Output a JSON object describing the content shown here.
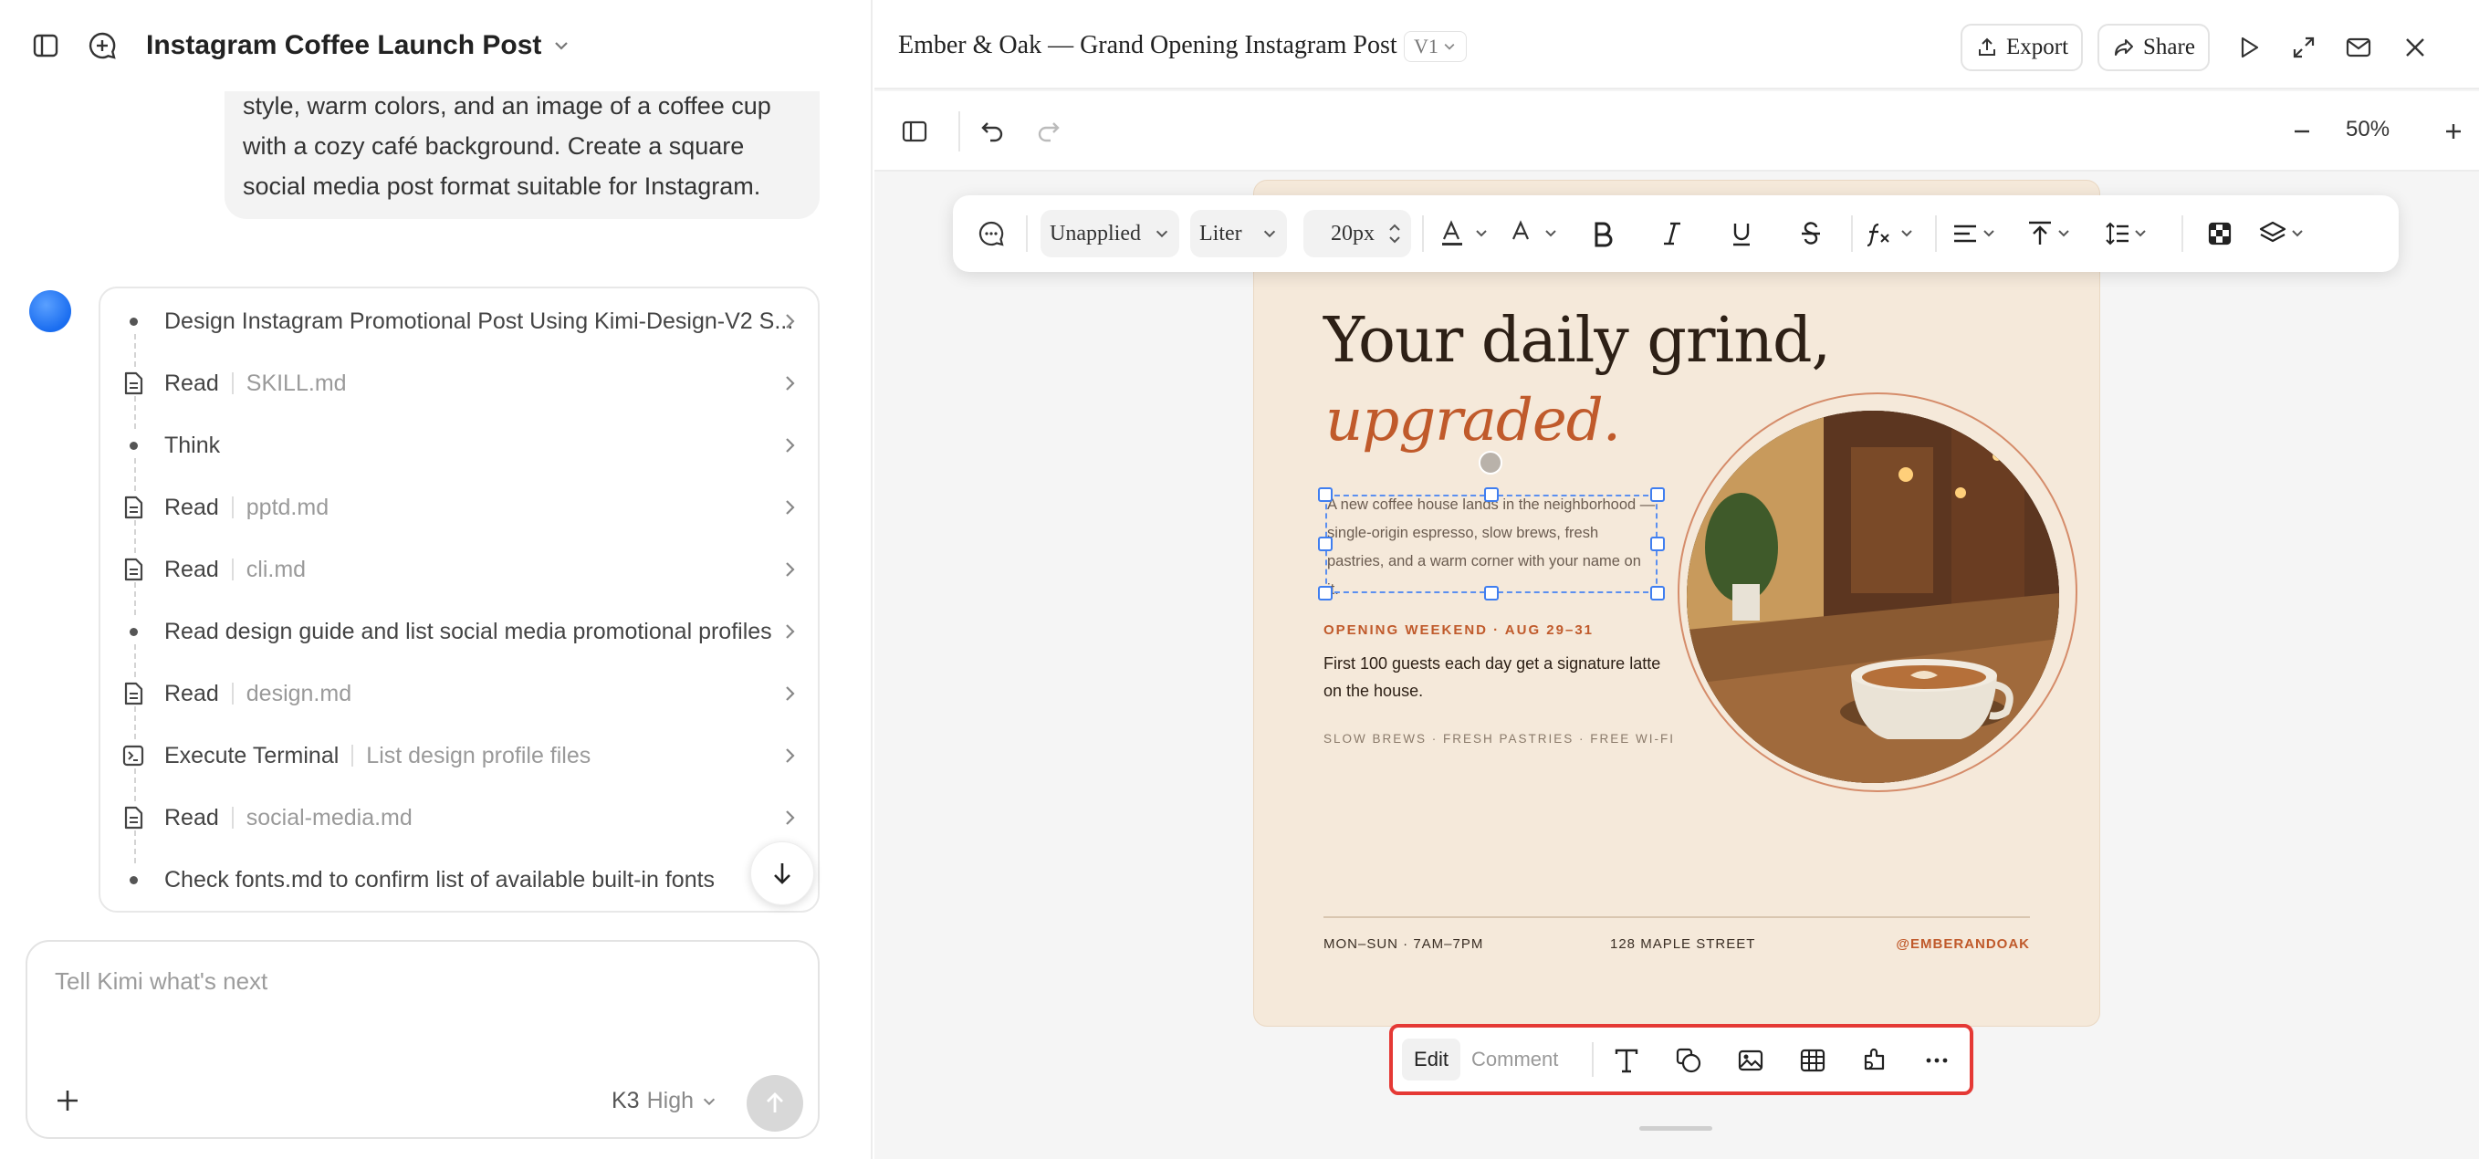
{
  "left": {
    "title": "Instagram Coffee Launch Post",
    "user_message": "style, warm colors, and an image of a coffee cup with a cozy café background. Create a square social media post format suitable for Instagram.",
    "steps": [
      {
        "kind": "dot",
        "label": "Design Instagram Promotional Post Using Kimi-Design-V2 S...",
        "sub": ""
      },
      {
        "kind": "file",
        "label": "Read",
        "sub": "SKILL.md"
      },
      {
        "kind": "dot",
        "label": "Think",
        "sub": ""
      },
      {
        "kind": "file",
        "label": "Read",
        "sub": "pptd.md"
      },
      {
        "kind": "file",
        "label": "Read",
        "sub": "cli.md"
      },
      {
        "kind": "dot",
        "label": "Read design guide and list social media promotional profiles",
        "sub": ""
      },
      {
        "kind": "file",
        "label": "Read",
        "sub": "design.md"
      },
      {
        "kind": "terminal",
        "label": "Execute Terminal",
        "sub": "List design profile files"
      },
      {
        "kind": "file",
        "label": "Read",
        "sub": "social-media.md"
      },
      {
        "kind": "dot",
        "label": "Check fonts.md to confirm list of available built-in fonts",
        "sub": ""
      }
    ],
    "composer": {
      "placeholder": "Tell Kimi what's next",
      "model": "K3",
      "level": "High"
    }
  },
  "right": {
    "doc_title": "Ember & Oak — Grand Opening Instagram Post",
    "version": "V1",
    "export_label": "Export",
    "share_label": "Share",
    "zoom": "50%",
    "text_toolbar": {
      "style": "Unapplied",
      "font": "Liter",
      "size": "20px"
    },
    "bottom_toolbar": {
      "edit": "Edit",
      "comment": "Comment"
    }
  },
  "poster": {
    "headline_1": "Your daily grind,",
    "headline_2": "upgraded.",
    "body": "A new coffee house lands in the neighborhood — single-origin espresso, slow brews, fresh pastries, and a warm corner with your name on it.",
    "opening": "OPENING WEEKEND · AUG 29–31",
    "guests": "First 100 guests each day get a signature latte on the house.",
    "tags": "SLOW BREWS · FRESH PASTRIES · FREE WI-FI",
    "hours": "MON–SUN · 7AM–7PM",
    "address": "128 MAPLE STREET",
    "handle": "@EMBERANDOAK"
  },
  "colors": {
    "accent": "#c05a2b",
    "poster_bg": "#f5e9da",
    "ink": "#2d2016",
    "selection": "#3f7ef0",
    "highlight": "#e53935"
  }
}
